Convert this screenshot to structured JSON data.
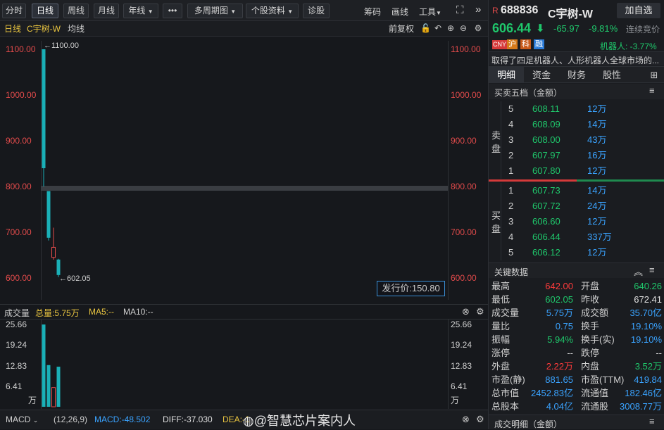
{
  "toolbar": {
    "tabs": [
      "分时",
      "日线",
      "周线",
      "月线",
      "年线",
      "•••",
      "多周期图",
      "个股资料",
      "诊股"
    ],
    "right_items": [
      "筹码",
      "画线",
      "工具"
    ]
  },
  "subbar": {
    "period": "日线",
    "stock": "C宇树-W",
    "ma": "均线",
    "adjust": "前复权"
  },
  "chart": {
    "y_labels": [
      "1100.00",
      "1000.00",
      "900.00",
      "800.00",
      "700.00",
      "600.00"
    ],
    "high_note": "←1100.00",
    "low_note": "←602.05",
    "issue_price": "发行价:150.80"
  },
  "chart_data": {
    "type": "candlestick",
    "ylim": [
      580,
      1120
    ],
    "candles": [
      {
        "open": 1100.0,
        "close": 840,
        "high": 1100.0,
        "low": 800,
        "color": "#1ab0b7"
      },
      {
        "open": 790,
        "close": 688,
        "high": 790,
        "low": 682,
        "color": "#1ab0b7"
      },
      {
        "open": 645,
        "close": 667,
        "high": 710,
        "low": 640,
        "color": "#e34b4b"
      },
      {
        "open": 640.26,
        "close": 606.44,
        "high": 642.0,
        "low": 602.05,
        "color": "#1ab0b7"
      }
    ],
    "volume": {
      "y_labels": [
        "25.66",
        "19.24",
        "12.83",
        "6.41",
        "万"
      ],
      "ylim": [
        0,
        27
      ],
      "values": [
        25.66,
        13,
        6,
        12.5
      ],
      "colors": [
        "#1ab0b7",
        "#1ab0b7",
        "#e34b4b",
        "#1ab0b7"
      ]
    }
  },
  "volume_header": {
    "title": "成交量",
    "total": "总量:5.75万",
    "ma5": "MA5:--",
    "ma10": "MA10:--"
  },
  "macd": {
    "label": "MACD",
    "params": "(12,26,9)",
    "macd": "MACD:-48.502",
    "diff": "DIFF:-37.030",
    "dea": "DEA:-1",
    "watermark": "@智慧芯片案内人"
  },
  "quote": {
    "prefix": "R",
    "code": "688836",
    "name": "C宇树-W",
    "add_button": "加自选",
    "price": "606.44",
    "change": "-65.97",
    "pct": "-9.81%",
    "auction": "连续竞价",
    "tags": [
      "CNY",
      "沪",
      "科",
      "融"
    ],
    "sector": "机器人: -3.77%",
    "desc": "取得了四足机器人、人形机器人全球市场的..."
  },
  "panel_tabs": [
    "明细",
    "资金",
    "财务",
    "股性"
  ],
  "orderbook": {
    "title": "买卖五档（金额）",
    "sell_label": [
      "卖",
      "盘"
    ],
    "buy_label": [
      "买",
      "盘"
    ],
    "sell": [
      {
        "n": "5",
        "price": "608.11",
        "vol": "12万"
      },
      {
        "n": "4",
        "price": "608.09",
        "vol": "14万"
      },
      {
        "n": "3",
        "price": "608.00",
        "vol": "43万"
      },
      {
        "n": "2",
        "price": "607.97",
        "vol": "16万"
      },
      {
        "n": "1",
        "price": "607.80",
        "vol": "12万"
      }
    ],
    "buy": [
      {
        "n": "1",
        "price": "607.73",
        "vol": "14万"
      },
      {
        "n": "2",
        "price": "607.72",
        "vol": "24万"
      },
      {
        "n": "3",
        "price": "606.60",
        "vol": "12万"
      },
      {
        "n": "4",
        "price": "606.44",
        "vol": "337万"
      },
      {
        "n": "5",
        "price": "606.12",
        "vol": "12万"
      }
    ]
  },
  "keydata": {
    "title": "关键数据",
    "rows": [
      {
        "k1": "最高",
        "v1": "642.00",
        "k2": "开盘",
        "v2": "640.26"
      },
      {
        "k1": "最低",
        "v1": "602.05",
        "k2": "昨收",
        "v2": "672.41"
      },
      {
        "k1": "成交量",
        "v1": "5.75万",
        "k2": "成交额",
        "v2": "35.70亿"
      },
      {
        "k1": "量比",
        "v1": "0.75",
        "k2": "换手",
        "v2": "19.10%"
      },
      {
        "k1": "振幅",
        "v1": "5.94%",
        "k2": "换手(实)",
        "v2": "19.10%"
      },
      {
        "k1": "涨停",
        "v1": "--",
        "k2": "跌停",
        "v2": "--"
      },
      {
        "k1": "外盘",
        "v1": "2.22万",
        "k2": "内盘",
        "v2": "3.52万"
      },
      {
        "k1": "市盈(静)",
        "v1": "881.65",
        "k2": "市盈(TTM)",
        "v2": "419.84"
      },
      {
        "k1": "总市值",
        "v1": "2452.83亿",
        "k2": "流通值",
        "v2": "182.46亿"
      },
      {
        "k1": "总股本",
        "v1": "4.04亿",
        "k2": "流通股",
        "v2": "3008.77万"
      }
    ]
  },
  "footer": {
    "title": "成交明细（金额）"
  }
}
